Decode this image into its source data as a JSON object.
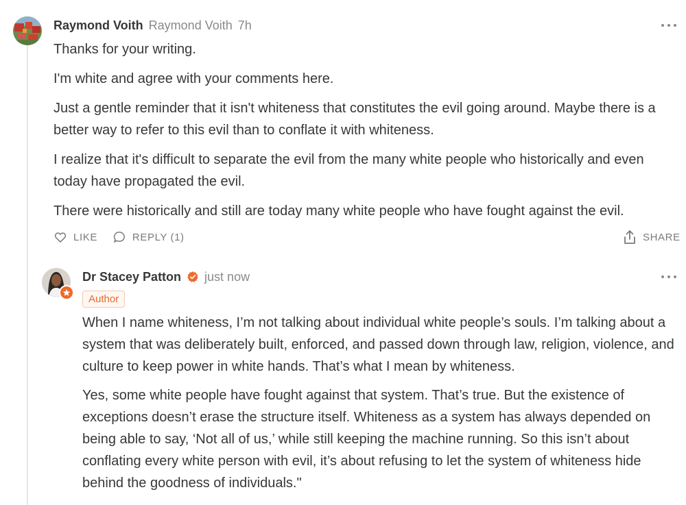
{
  "comment": {
    "author_name": "Raymond Voith",
    "author_handle": "Raymond Voith",
    "time": "7h",
    "paragraphs": [
      "Thanks for your writing.",
      "I'm white and agree with your comments here.",
      "Just a gentle reminder that it isn't whiteness that constitutes the evil going around. Maybe there is a better way to refer to this evil than to conflate it with whiteness.",
      "I realize that it's difficult to separate the evil from the many white people who historically and even today have propagated the evil.",
      "There were historically and still are today many white people who have fought against the evil."
    ],
    "actions": {
      "like": "LIKE",
      "reply": "REPLY (1)",
      "share": "SHARE"
    }
  },
  "reply": {
    "author_name": "Dr Stacey Patton",
    "time": "just now",
    "badge": "Author",
    "paragraphs": [
      "When I name whiteness, I’m not talking about individual white people’s souls. I’m talking about a system that was deliberately built, enforced, and passed down through law, religion, violence, and culture to keep power in white hands. That’s what I mean by whiteness.",
      "Yes, some white people have fought against that system. That’s true. But the existence of exceptions doesn’t erase the structure itself. Whiteness as a system has always depended on being able to say, ‘Not all of us,’ while still keeping the machine running. So this isn’t about conflating every white person with evil, it’s about refusing to let the system of whiteness hide behind the goodness of individuals.\""
    ]
  },
  "icons": {
    "more": "more-horizontal-icon",
    "like": "heart-icon",
    "reply": "speech-bubble-icon",
    "share": "share-upload-icon",
    "verified": "verified-check-icon",
    "author_star": "star-icon"
  },
  "colors": {
    "text": "#363737",
    "muted": "#8a8a8a",
    "accent": "#ef6a2a",
    "thread_line": "#e6e6e6"
  }
}
